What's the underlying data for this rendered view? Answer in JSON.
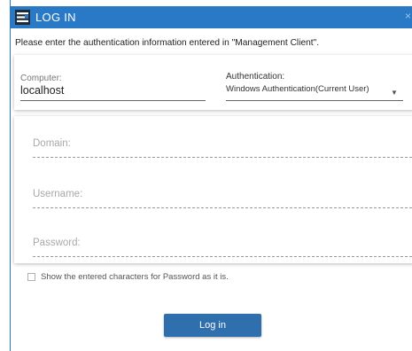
{
  "window": {
    "title": "LOG IN",
    "close_glyph": "×",
    "app_icon": "app-logo-icon",
    "titlebar_color": "#2a79c6"
  },
  "instruction": "Please enter the authentication information entered in \"Management Client\".",
  "connection": {
    "computer_label": "Computer:",
    "computer_value": "localhost",
    "auth_label": "Authentication:",
    "auth_value": "Windows Authentication(Current User)",
    "auth_dropdown_icon": "chevron-down-icon"
  },
  "credentials": {
    "domain_placeholder": "Domain:",
    "username_placeholder": "Username:",
    "password_placeholder": "Password:"
  },
  "show_password": {
    "label": "Show the entered characters for Password as it is.",
    "checked": false
  },
  "login_button": {
    "label": "Log in",
    "color": "#2f6fae"
  }
}
